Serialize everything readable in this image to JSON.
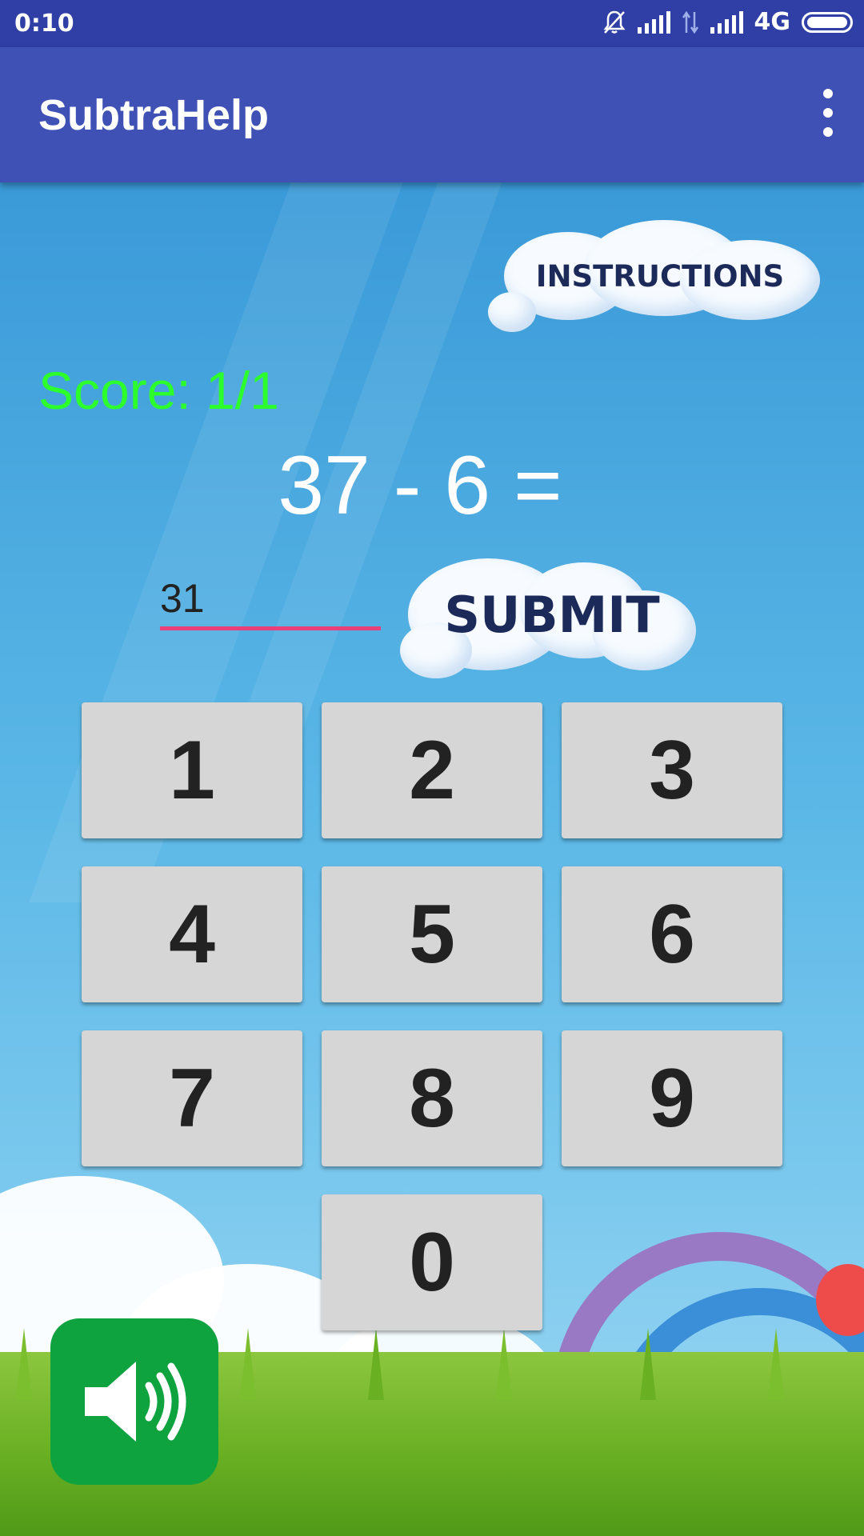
{
  "status_bar": {
    "time": "0:10",
    "network": "4G"
  },
  "app_bar": {
    "title": "SubtraHelp",
    "overflow_icon": "more-vert-icon"
  },
  "buttons": {
    "instructions_label": "INSTRUCTIONS",
    "submit_label": "SUBMIT",
    "sound_icon": "speaker-volume-icon"
  },
  "score": {
    "label": "Score: 1/1"
  },
  "problem": {
    "text": "37 - 6 ="
  },
  "answer": {
    "value": "31"
  },
  "keypad": {
    "keys": [
      "1",
      "2",
      "3",
      "4",
      "5",
      "6",
      "7",
      "8",
      "9",
      "0"
    ]
  },
  "colors": {
    "status_bar": "#2f3fa6",
    "app_bar": "#3f51b5",
    "score": "#2cff2c",
    "input_underline": "#e9407a",
    "key": "#d6d6d6",
    "sound_button": "#0ea33f"
  }
}
